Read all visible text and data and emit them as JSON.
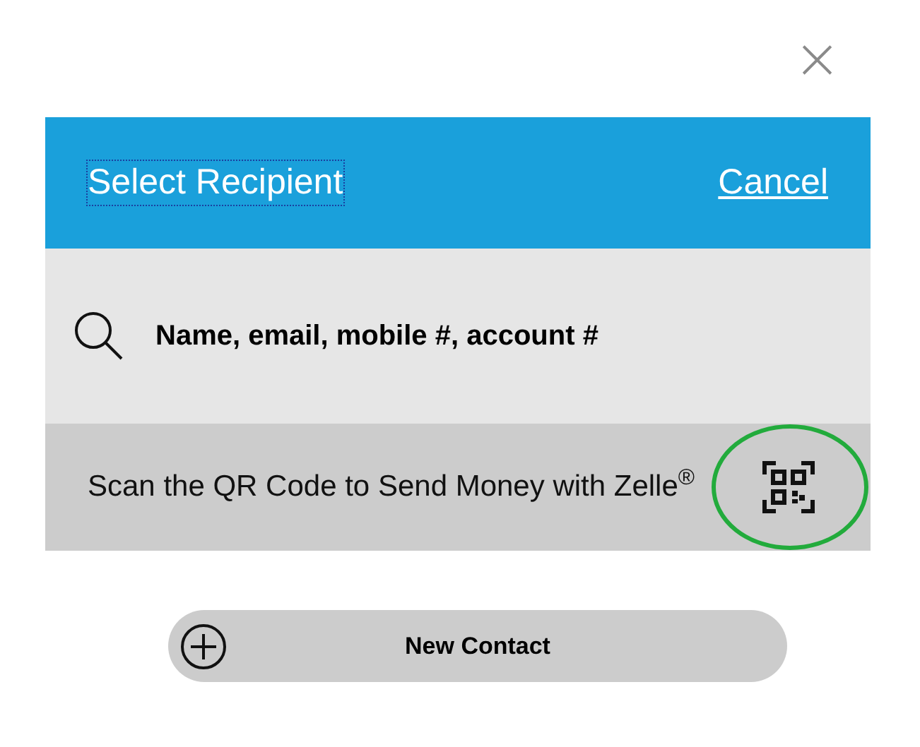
{
  "close_button": {
    "label": "×"
  },
  "header": {
    "title": "Select Recipient",
    "title_focused": true,
    "cancel": "Cancel"
  },
  "search": {
    "placeholder": "Name, email, mobile #, account #"
  },
  "qr_row": {
    "text": "Scan the QR Code to Send Money with Zelle$^{®}$",
    "highlighted": true
  },
  "new_contact": {
    "label": "New Contact"
  }
}
